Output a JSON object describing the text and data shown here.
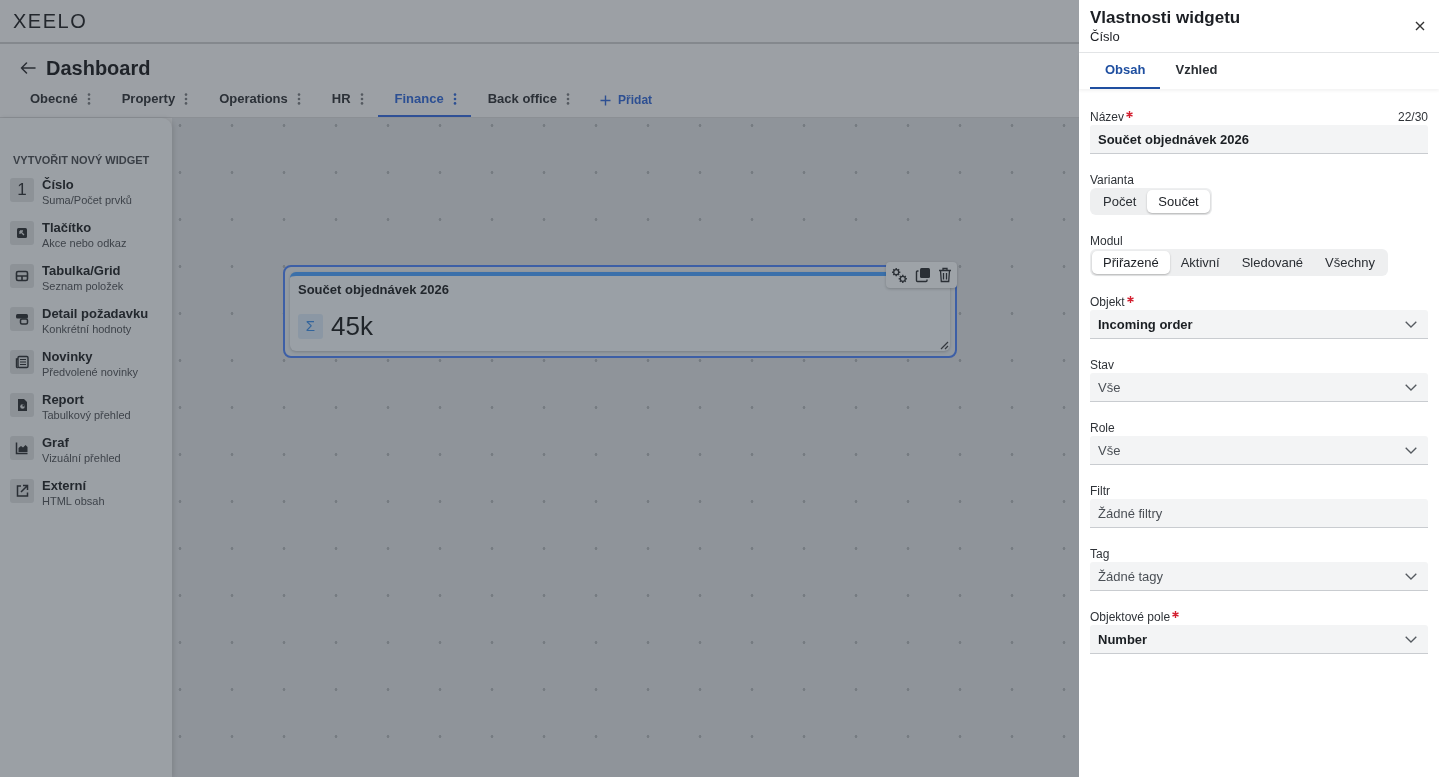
{
  "header": {
    "logo": "XEELO"
  },
  "page": {
    "title": "Dashboard"
  },
  "tabs": [
    {
      "label": "Obecné",
      "selected": false
    },
    {
      "label": "Property",
      "selected": false
    },
    {
      "label": "Operations",
      "selected": false
    },
    {
      "label": "HR",
      "selected": false
    },
    {
      "label": "Finance",
      "selected": true
    },
    {
      "label": "Back office",
      "selected": false
    }
  ],
  "add_tab": {
    "label": "Přidat"
  },
  "sidebar": {
    "title": "VYTVOŘIT NOVÝ WIDGET",
    "items": [
      {
        "kind": "glyph",
        "glyph": "1",
        "title": "Číslo",
        "subtitle": "Suma/Počet prvků"
      },
      {
        "kind": "icon",
        "title": "Tlačítko",
        "subtitle": "Akce nebo odkaz"
      },
      {
        "kind": "icon",
        "title": "Tabulka/Grid",
        "subtitle": "Seznam položek"
      },
      {
        "kind": "icon",
        "title": "Detail požadavku",
        "subtitle": "Konkrétní hodnoty"
      },
      {
        "kind": "icon",
        "title": "Novinky",
        "subtitle": "Předvolené novinky"
      },
      {
        "kind": "icon",
        "title": "Report",
        "subtitle": "Tabulkový přehled"
      },
      {
        "kind": "icon",
        "title": "Graf",
        "subtitle": "Vizuální přehled"
      },
      {
        "kind": "icon",
        "title": "Externí",
        "subtitle": "HTML obsah"
      }
    ]
  },
  "canvas": {
    "widgets": [
      {
        "title": "Součet objednávek 2026",
        "glyph": "Σ",
        "value": "45k",
        "selected": true
      }
    ]
  },
  "panel": {
    "title": "Vlastnosti widgetu",
    "subtitle": "Číslo",
    "tabs": [
      {
        "label": "Obsah",
        "selected": true
      },
      {
        "label": "Vzhled",
        "selected": false
      }
    ],
    "fields": [
      {
        "kind": "text",
        "label": "Název",
        "required": true,
        "counter": "22/30",
        "value": "Součet objednávek 2026"
      },
      {
        "kind": "segmented",
        "label": "Varianta",
        "options": [
          {
            "label": "Počet",
            "selected": false
          },
          {
            "label": "Součet",
            "selected": true
          }
        ]
      },
      {
        "kind": "segmented",
        "label": "Modul",
        "options": [
          {
            "label": "Přiřazené",
            "selected": true
          },
          {
            "label": "Aktivní",
            "selected": false
          },
          {
            "label": "Sledované",
            "selected": false
          },
          {
            "label": "Všechny",
            "selected": false
          }
        ]
      },
      {
        "kind": "select",
        "label": "Objekt",
        "required": true,
        "value": "Incoming order"
      },
      {
        "kind": "select",
        "label": "Stav",
        "required": false,
        "placeholder": "Vše"
      },
      {
        "kind": "select",
        "label": "Role",
        "required": false,
        "placeholder": "Vše"
      },
      {
        "kind": "text",
        "label": "Filtr",
        "required": false,
        "placeholder": "Žádné filtry"
      },
      {
        "kind": "select",
        "label": "Tag",
        "required": false,
        "placeholder": "Žádné tagy"
      },
      {
        "kind": "select",
        "label": "Objektové pole",
        "required": true,
        "value": "Number"
      }
    ]
  }
}
